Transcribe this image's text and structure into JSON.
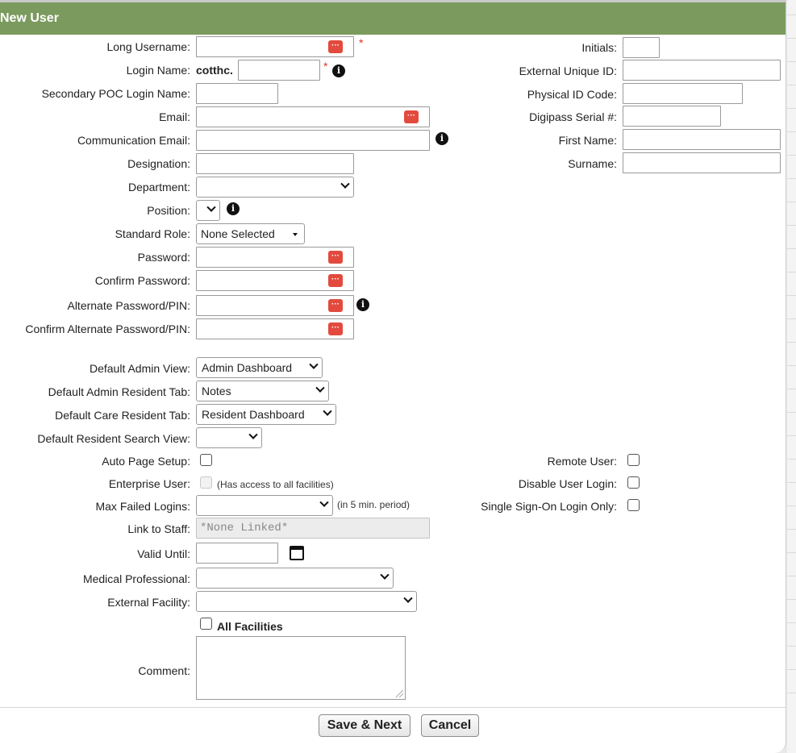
{
  "dialog": {
    "title": "New User"
  },
  "left": {
    "long_username": "Long Username:",
    "login_name": "Login Name:",
    "login_prefix": "cotthc.",
    "secondary_poc": "Secondary POC Login Name:",
    "email": "Email:",
    "communication_email": "Communication Email:",
    "designation": "Designation:",
    "department": "Department:",
    "position": "Position:",
    "standard_role": "Standard Role:",
    "standard_role_value": "None Selected",
    "password": "Password:",
    "confirm_password": "Confirm Password:",
    "alt_password": "Alternate Password/PIN:",
    "confirm_alt_password": "Confirm Alternate Password/PIN:",
    "default_admin_view": "Default Admin View:",
    "default_admin_view_value": "Admin Dashboard",
    "default_admin_resident_tab": "Default Admin Resident Tab:",
    "default_admin_resident_tab_value": "Notes",
    "default_care_resident_tab": "Default Care Resident Tab:",
    "default_care_resident_tab_value": "Resident Dashboard",
    "default_resident_search_view": "Default Resident Search View:",
    "auto_page_setup": "Auto Page Setup:",
    "enterprise_user": "Enterprise User:",
    "enterprise_note": "(Has access to all facilities)",
    "max_failed_logins": "Max Failed Logins:",
    "max_failed_note": "(in 5 min. period)",
    "link_to_staff": "Link to Staff:",
    "link_to_staff_value": "*None Linked*",
    "valid_until": "Valid Until:",
    "medical_professional": "Medical Professional:",
    "external_facility": "External Facility:",
    "all_facilities": "All Facilities",
    "comment": "Comment:"
  },
  "right": {
    "initials": "Initials:",
    "external_unique_id": "External Unique ID:",
    "physical_id_code": "Physical ID Code:",
    "digipass_serial": "Digipass Serial #:",
    "first_name": "First Name:",
    "surname": "Surname:",
    "remote_user": "Remote User:",
    "disable_user_login": "Disable User Login:",
    "single_sign_on": "Single Sign-On Login Only:"
  },
  "marks": {
    "required": "*",
    "info": "i",
    "password_icon": "···"
  },
  "footer": {
    "save_next": "Save & Next",
    "cancel": "Cancel"
  }
}
